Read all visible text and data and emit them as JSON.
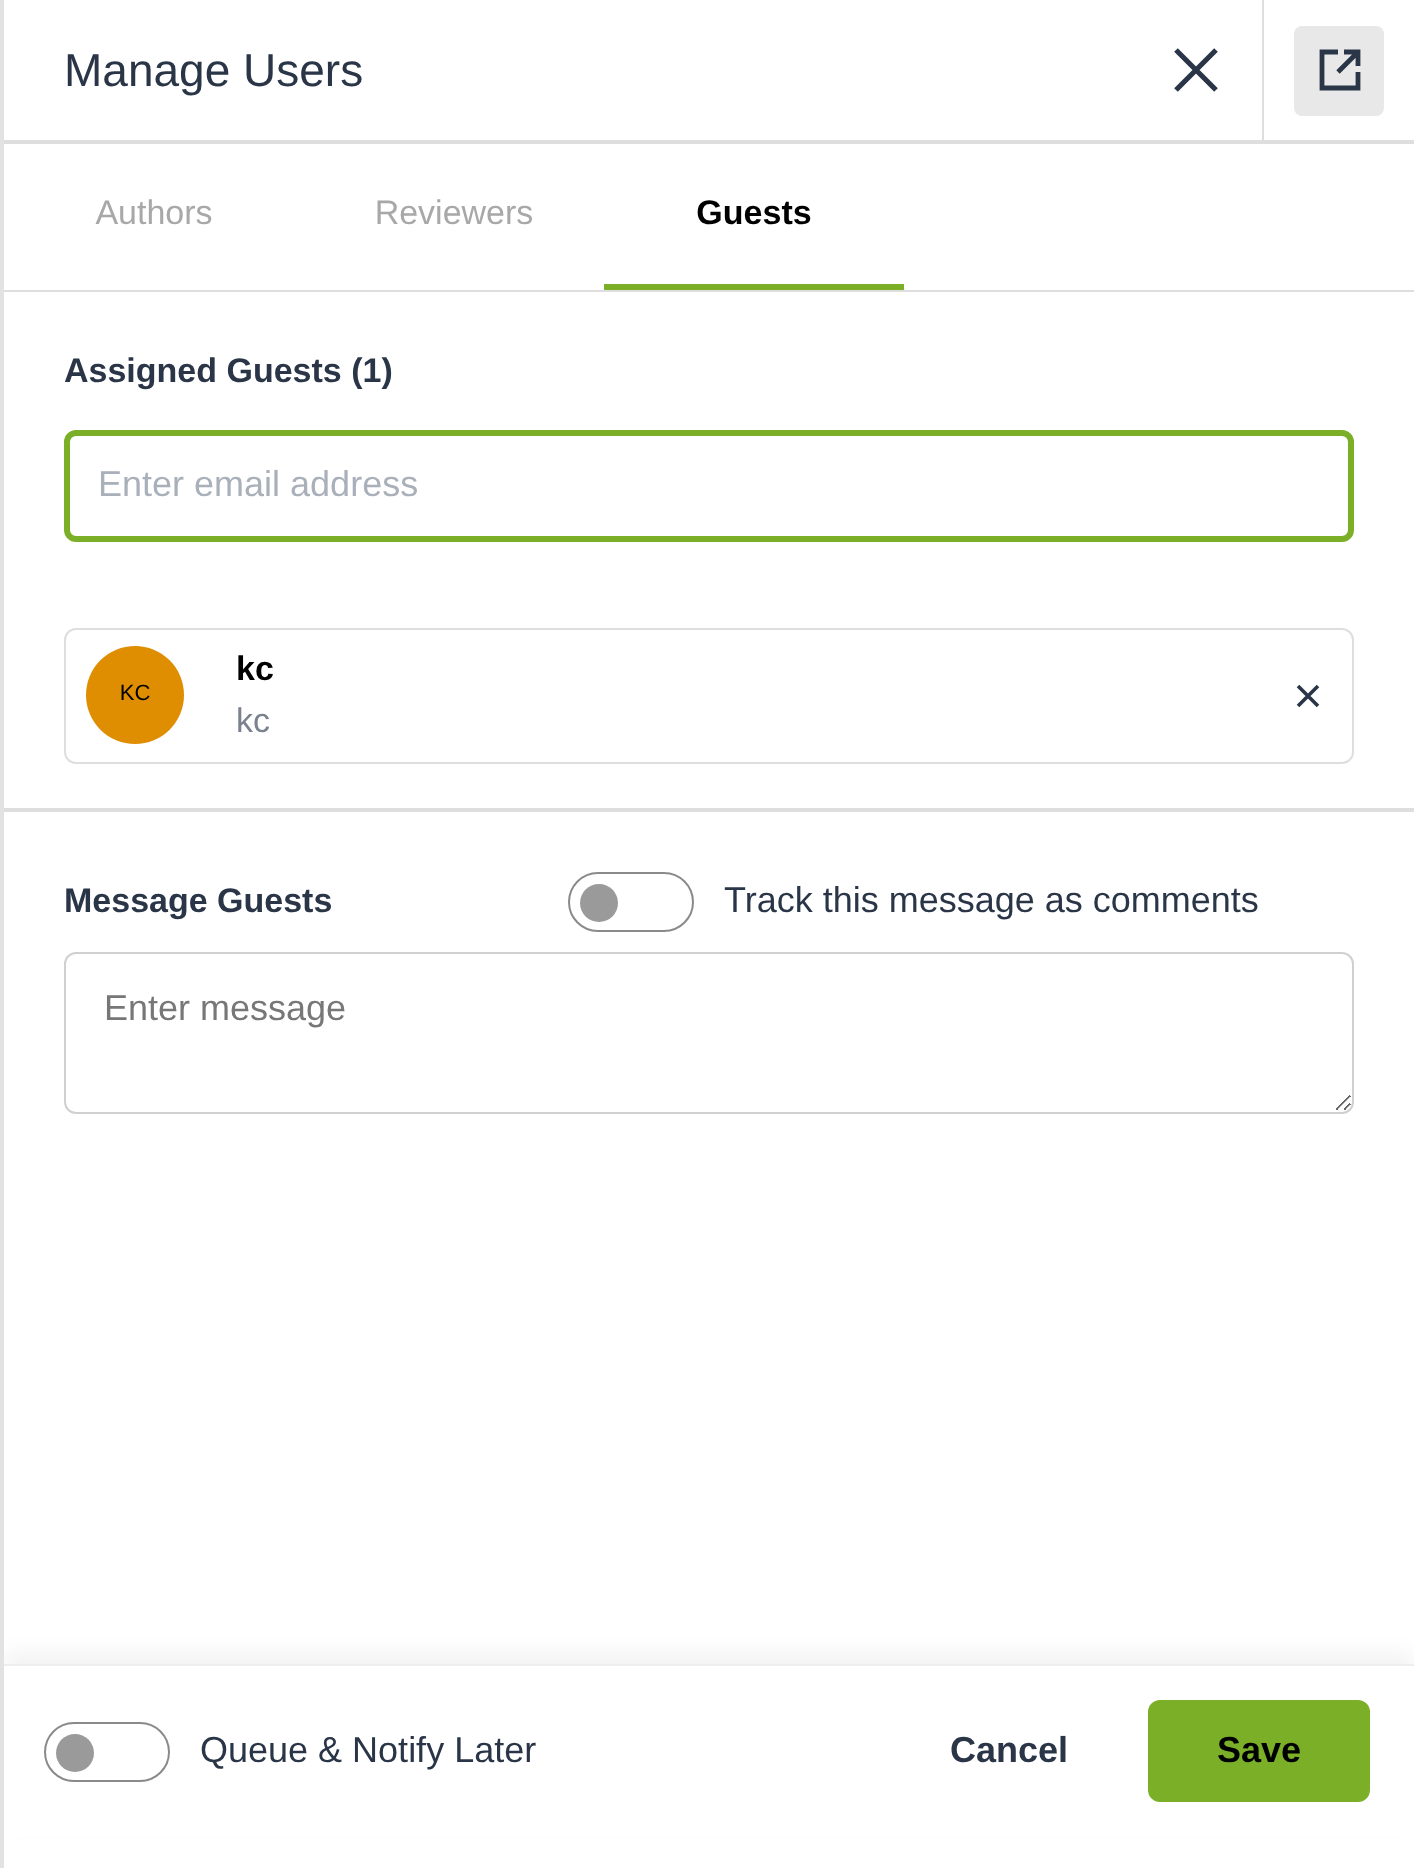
{
  "header": {
    "title": "Manage Users"
  },
  "tabs": [
    {
      "label": "Authors",
      "selected": false
    },
    {
      "label": "Reviewers",
      "selected": false
    },
    {
      "label": "Guests",
      "selected": true
    }
  ],
  "assigned": {
    "heading": "Assigned Guests (1)",
    "email_field": {
      "placeholder": "Enter email address"
    },
    "guests": [
      {
        "initials": "KC",
        "name": "kc",
        "email": "kc"
      }
    ]
  },
  "message": {
    "heading": "Message Guests",
    "track_toggle": {
      "label": "Track this message as comments",
      "on": false
    },
    "field": {
      "placeholder": "Enter message"
    }
  },
  "footer": {
    "queue_toggle": {
      "label": "Queue & Notify Later",
      "on": false
    },
    "buttons": {
      "cancel": "Cancel",
      "save": "Save"
    }
  }
}
